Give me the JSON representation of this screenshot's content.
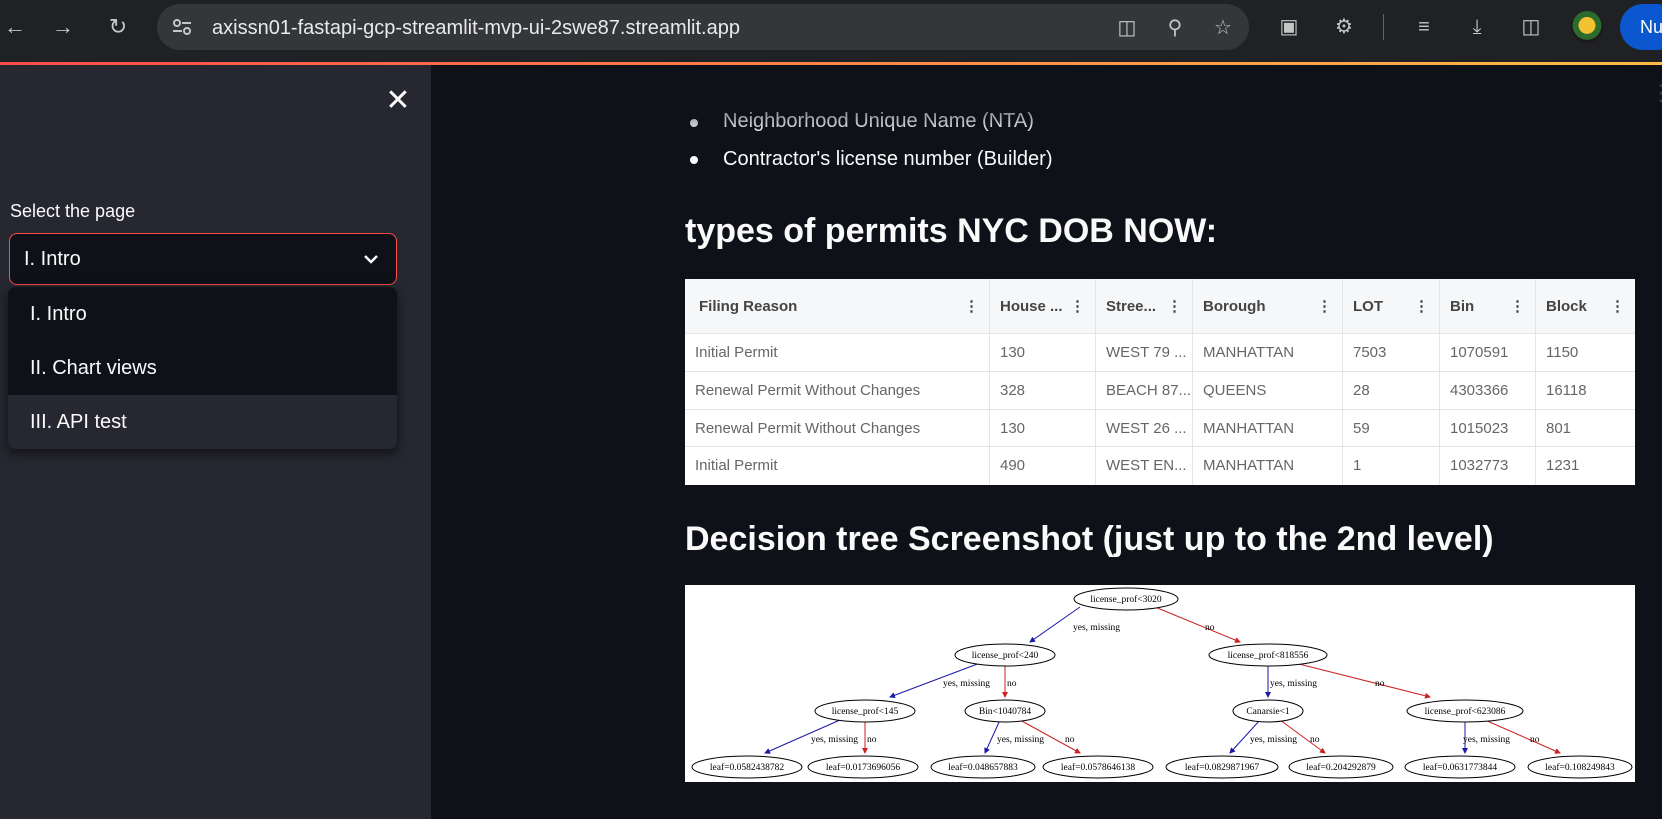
{
  "browser": {
    "url": "axissn01-fastapi-gcp-streamlit-mvp-ui-2swe87.streamlit.app",
    "profile_initials": "Nu"
  },
  "sidebar": {
    "select_label": "Select the page",
    "selected_value": "I. Intro",
    "options": [
      "I. Intro",
      "II. Chart views",
      "III. API test"
    ]
  },
  "main": {
    "bullets": [
      "Neighborhood Unique Name (NTA)",
      "Contractor's license number (Builder)"
    ],
    "permits_heading": "types of permits NYC DOB NOW:",
    "table": {
      "headers": [
        "Filing Reason",
        "House ...",
        "Stree...",
        "Borough",
        "LOT",
        "Bin",
        "Block"
      ],
      "rows": [
        [
          "Initial Permit",
          "130",
          "WEST 79 ...",
          "MANHATTAN",
          "7503",
          "1070591",
          "1150"
        ],
        [
          "Renewal Permit Without Changes",
          "328",
          "BEACH 87...",
          "QUEENS",
          "28",
          "4303366",
          "16118"
        ],
        [
          "Renewal Permit Without Changes",
          "130",
          "WEST 26 ...",
          "MANHATTAN",
          "59",
          "1015023",
          "801"
        ],
        [
          "Initial Permit",
          "490",
          "WEST EN...",
          "MANHATTAN",
          "1",
          "1032773",
          "1231"
        ]
      ]
    },
    "tree_heading": "Decision tree Screenshot (just up to the 2nd level)",
    "tree": {
      "nodes": [
        "license_prof<3020",
        "license_prof<240",
        "license_prof<818556",
        "license_prof<145",
        "Bin<1040784",
        "Canarsie<1",
        "license_prof<623086"
      ],
      "leaves": [
        "leaf=0.0582438782",
        "leaf=0.0173696056",
        "leaf=0.048657883",
        "leaf=0.0578646138",
        "leaf=0.0829871967",
        "leaf=0.204292879",
        "leaf=0.0631773844",
        "leaf=0.108249843"
      ],
      "yes_label": "yes, missing",
      "no_label": "no"
    }
  }
}
